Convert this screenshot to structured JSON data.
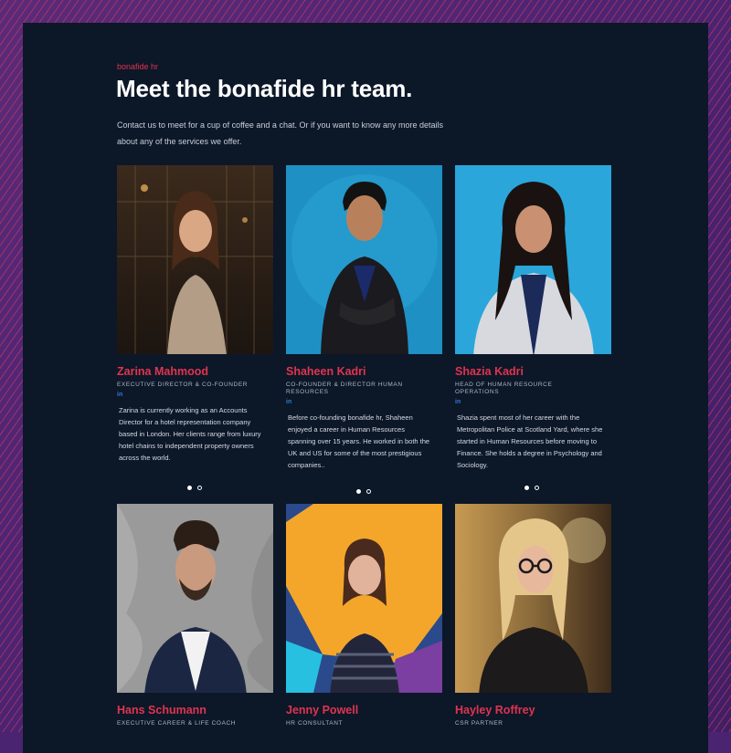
{
  "brand": "bonafide hr",
  "heading": "Meet the bonafide hr team.",
  "intro": "Contact us to meet for a cup of coffee and a chat. Or if you want to know any more details about any of the services we offer.",
  "linkedin_label": "in",
  "colors": {
    "accent": "#e0344f",
    "panel": "#0c1728",
    "frame": "#4a2470",
    "linkedin": "#2e7bd8"
  },
  "team": [
    {
      "name": "Zarina Mahmood",
      "role": "Executive Director & Co-Founder",
      "bio": "Zarina is currently working as an Accounts Director for a hotel representation company based in London. Her clients range from luxury hotel chains to independent property owners across the world."
    },
    {
      "name": "Shaheen Kadri",
      "role": "Co-Founder & Director Human Resources",
      "bio": "Before co-founding bonafide hr, Shaheen enjoyed a career in Human Resources spanning over 15 years. He worked in both the UK and US for some of the most prestigious companies.."
    },
    {
      "name": "Shazia Kadri",
      "role": "Head of Human Resource Operations",
      "bio": "Shazia spent most of her career with the Metropolitan Police at Scotland Yard, where she started in Human Resources before moving to Finance. She holds a degree in Psychology and Sociology."
    },
    {
      "name": "Hans Schumann",
      "role": "Executive Career & Life Coach",
      "bio": ""
    },
    {
      "name": "Jenny Powell",
      "role": "HR Consultant",
      "bio": ""
    },
    {
      "name": "Hayley Roffrey",
      "role": "CSR Partner",
      "bio": ""
    }
  ]
}
